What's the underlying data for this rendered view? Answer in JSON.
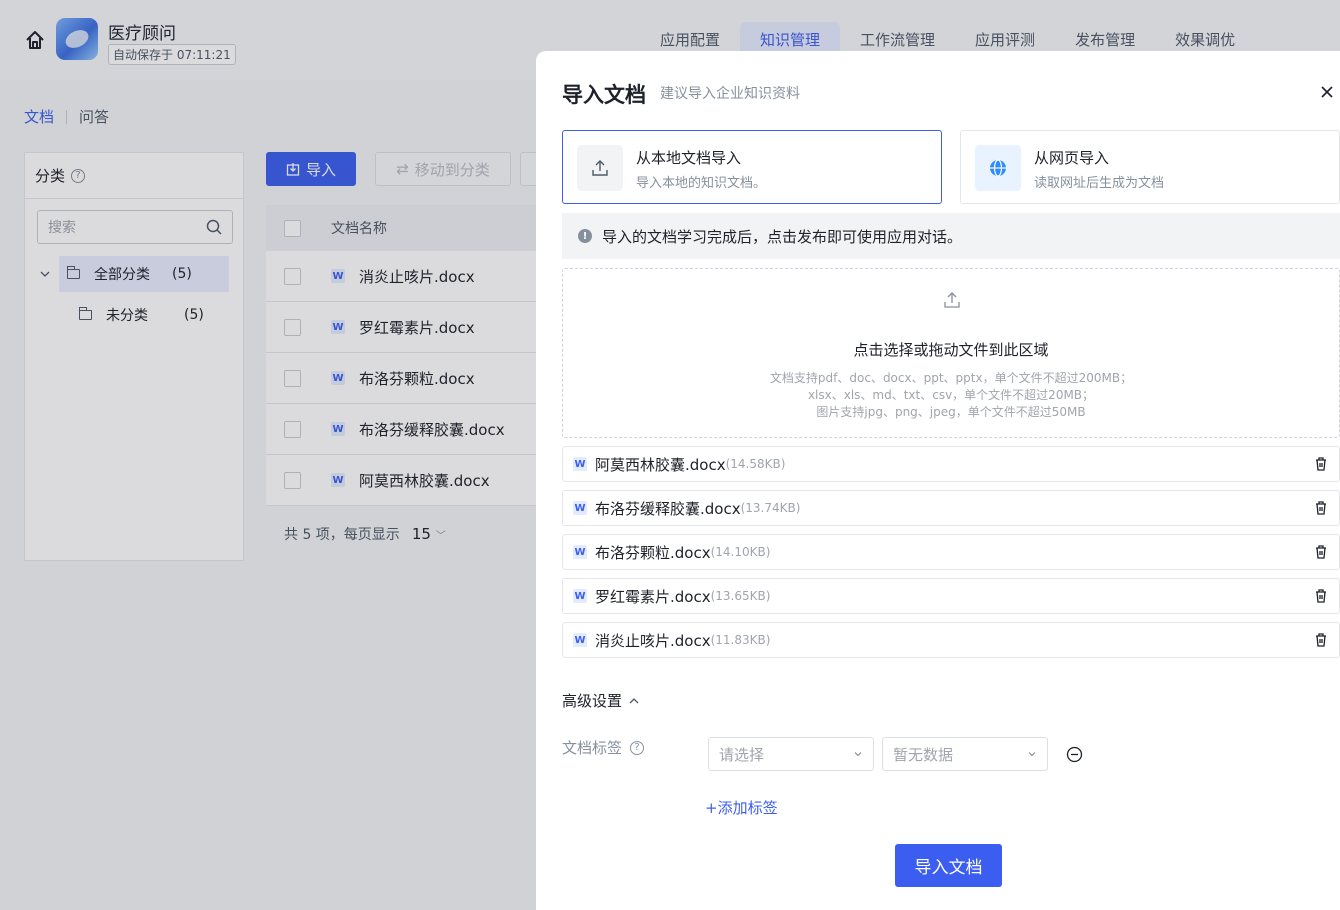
{
  "app": {
    "name": "医疗顾问",
    "autosave": "自动保存于 07:11:21",
    "top_tabs": [
      "应用配置",
      "知识管理",
      "工作流管理",
      "应用评测",
      "发布管理",
      "效果调优"
    ],
    "sub_tabs": [
      "文档",
      "问答"
    ]
  },
  "category": {
    "title": "分类",
    "search_placeholder": "搜索",
    "all": "全部分类",
    "all_count": "(5)",
    "uncat": "未分类",
    "uncat_count": "(5)"
  },
  "toolbar": {
    "import_label": "导入",
    "move_label": "移动到分类"
  },
  "table": {
    "header_name": "文档名称",
    "rows": [
      "消炎止咳片.docx",
      "罗红霉素片.docx",
      "布洛芬颗粒.docx",
      "布洛芬缓释胶囊.docx",
      "阿莫西林胶囊.docx"
    ],
    "pager_text": "共 5 项，每页显示",
    "page_size": "15"
  },
  "drawer": {
    "title": "导入文档",
    "subtitle": "建议导入企业知识资料",
    "local": {
      "title": "从本地文档导入",
      "desc": "导入本地的知识文档。"
    },
    "web": {
      "title": "从网页导入",
      "desc": "读取网址后生成为文档"
    },
    "info": "导入的文档学习完成后，点击发布即可使用应用对话。",
    "dropzone": {
      "title": "点击选择或拖动文件到此区域",
      "hint1": "文档支持pdf、doc、docx、ppt、pptx，单个文件不超过200MB；",
      "hint2": "xlsx、xls、md、txt、csv，单个文件不超过20MB；",
      "hint3": "图片支持jpg、png、jpeg，单个文件不超过50MB"
    },
    "files": [
      {
        "name": "阿莫西林胶囊.docx",
        "size": "(14.58KB)"
      },
      {
        "name": "布洛芬缓释胶囊.docx",
        "size": "(13.74KB)"
      },
      {
        "name": "布洛芬颗粒.docx",
        "size": "(14.10KB)"
      },
      {
        "name": "罗红霉素片.docx",
        "size": "(13.65KB)"
      },
      {
        "name": "消炎止咳片.docx",
        "size": "(11.83KB)"
      }
    ],
    "advanced": "高级设置",
    "tag_label": "文档标签",
    "select_placeholder": "请选择",
    "no_data": "暂无数据",
    "add_tag": "+添加标签",
    "submit": "导入文档"
  },
  "colors": {
    "primary": "#3c5ef0",
    "overlay": "rgba(40,44,52,0.17)"
  }
}
